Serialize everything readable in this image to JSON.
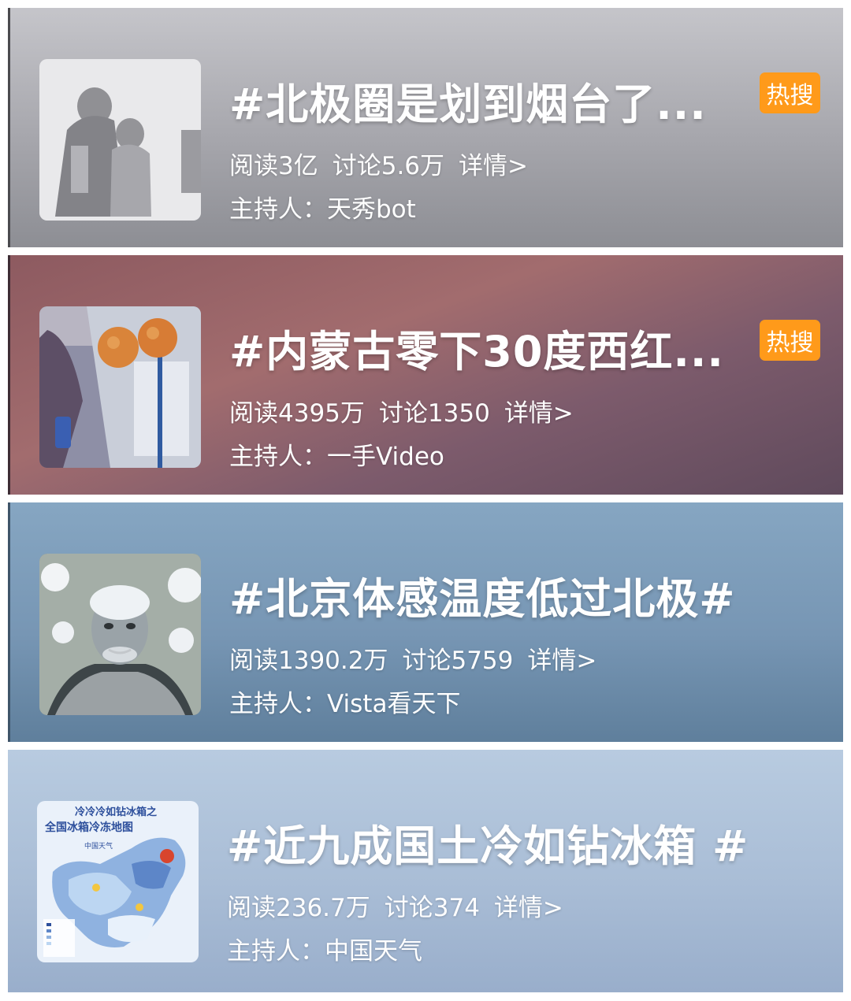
{
  "topics": [
    {
      "title": "#北极圈是划到烟台了...",
      "badge": "热搜",
      "reads": "阅读3亿",
      "discussions": "讨论5.6万",
      "details": "详情>",
      "host": "主持人：天秀bot"
    },
    {
      "title": "#内蒙古零下30度西红...",
      "badge": "热搜",
      "reads": "阅读4395万",
      "discussions": "讨论1350",
      "details": "详情>",
      "host": "主持人：一手Video"
    },
    {
      "title": "#北京体感温度低过北极#",
      "reads": "阅读1390.2万",
      "discussions": "讨论5759",
      "details": "详情>",
      "host": "主持人：Vista看天下"
    },
    {
      "title": "#近九成国土冷如钻冰箱 #",
      "reads": "阅读236.7万",
      "discussions": "讨论374",
      "details": "详情>",
      "host": "主持人：中国天气",
      "thumb_text": {
        "line1": "冷冷冷如钻冰箱之",
        "line2": "全国冰箱冷冻地图",
        "brand": "中国天气"
      }
    }
  ],
  "colors": {
    "badge": "#ff9a1a",
    "text": "#ffffff"
  }
}
